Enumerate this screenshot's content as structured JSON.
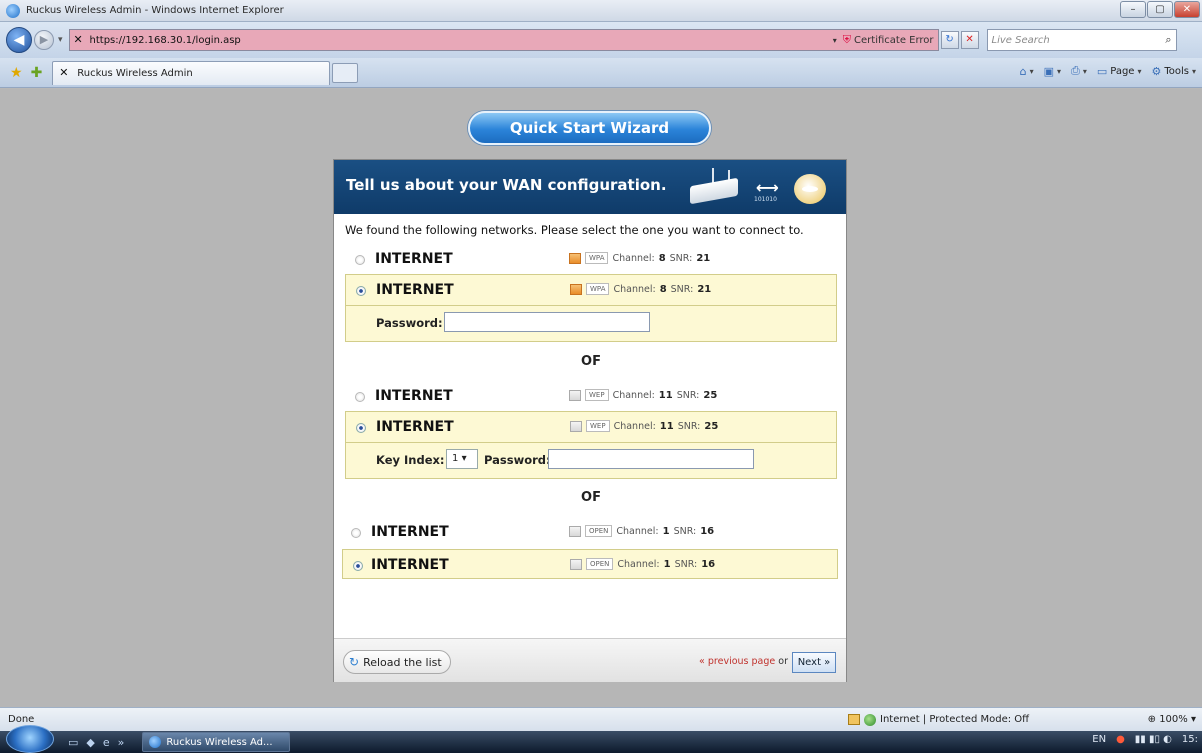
{
  "window": {
    "title": "Ruckus Wireless Admin - Windows Internet Explorer",
    "minimize": "–",
    "maximize": "▢",
    "close": "✕"
  },
  "address_bar": {
    "url": "https://192.168.30.1/login.asp",
    "certificate_error": "Certificate Error",
    "search_placeholder": "Live Search",
    "back_icon": "◀",
    "forward_icon": "▶",
    "history_icon": "▾",
    "refresh_icon": "↻",
    "stop_icon": "✕",
    "search_icon": "⌕",
    "address_bg_color": "#e8a8b8"
  },
  "tabs": {
    "active_tab": "Ruckus Wireless Admin"
  },
  "command_bar": {
    "home_icon": "⌂",
    "feeds_icon": "▣",
    "print_icon": "⎙",
    "page_label": "Page",
    "tools_label": "Tools",
    "dropdown_icon": "▾"
  },
  "wizard": {
    "title": "Quick Start Wizard",
    "heading": "Tell us about your WAN configuration.",
    "intro": "We found the following networks. Please select the one you want to connect to.",
    "networks": [
      {
        "ssid": "INTERNET",
        "security": "WPA",
        "channel_label": "Channel:",
        "channel": "8",
        "snr_label": "SNR:",
        "snr": "21",
        "selected": false
      },
      {
        "ssid": "INTERNET",
        "security": "WPA",
        "channel_label": "Channel:",
        "channel": "8",
        "snr_label": "SNR:",
        "snr": "21",
        "selected": true
      },
      {
        "ssid": "INTERNET",
        "security": "WEP",
        "channel_label": "Channel:",
        "channel": "11",
        "snr_label": "SNR:",
        "snr": "25",
        "selected": false
      },
      {
        "ssid": "INTERNET",
        "security": "WEP",
        "channel_label": "Channel:",
        "channel": "11",
        "snr_label": "SNR:",
        "snr": "25",
        "selected": true
      },
      {
        "ssid": "INTERNET",
        "security": "OPEN",
        "channel_label": "Channel:",
        "channel": "1",
        "snr_label": "SNR:",
        "snr": "16",
        "selected": false
      },
      {
        "ssid": "INTERNET",
        "security": "OPEN",
        "channel_label": "Channel:",
        "channel": "1",
        "snr_label": "SNR:",
        "snr": "16",
        "selected": true
      }
    ],
    "password_label": "Password:",
    "password_value": "",
    "key_index_label": "Key Index:",
    "key_index_value": "1",
    "select_arrow": "▾",
    "or_separator": "OF",
    "binary_text": "101010",
    "reload_label": "Reload the list",
    "reload_icon": "↻",
    "previous_label": "« previous page",
    "or_text": "or",
    "next_label": "Next »"
  },
  "status_bar": {
    "status": "Done",
    "zone": "Internet | Protected Mode: Off",
    "zoom": "100%",
    "zoom_icon": "⊕"
  },
  "taskbar": {
    "quicklaunch": [
      "▭",
      "◆",
      "e"
    ],
    "chevron": "»",
    "window_button": "Ruckus Wireless Ad...",
    "language": "EN",
    "tray_icons": "▮▮ ▮▯ ◐",
    "clock": "15:",
    "accent_color": "#1c6cc0"
  }
}
